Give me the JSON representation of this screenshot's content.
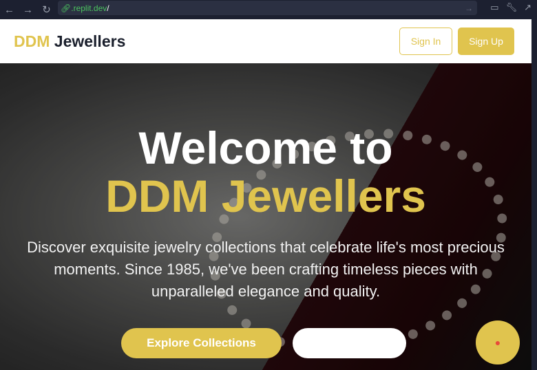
{
  "browser": {
    "url_host": ".replit.dev",
    "url_path": "/"
  },
  "header": {
    "logo_accent": "DDM",
    "logo_rest": "Jewellers",
    "sign_in": "Sign In",
    "sign_up": "Sign Up"
  },
  "hero": {
    "title_line1": "Welcome to",
    "title_line2": "DDM Jewellers",
    "description": "Discover exquisite jewelry collections that celebrate life's most precious moments. Since 1985, we've been crafting timeless pieces with unparalleled elegance and quality.",
    "explore_button": "Explore Collections",
    "secondary_button": ""
  },
  "colors": {
    "accent": "#e0c44e",
    "header_text": "#1a1f2c"
  },
  "fab": {
    "icon": "assistant-icon"
  }
}
